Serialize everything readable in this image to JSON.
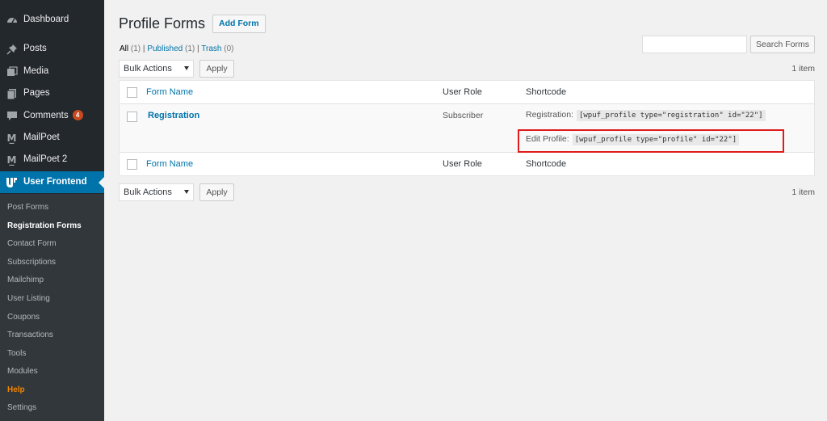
{
  "sidebar": {
    "menu": [
      {
        "label": "Dashboard",
        "icon": "dashboard-icon"
      },
      {
        "label": "Posts",
        "icon": "pin-icon"
      },
      {
        "label": "Media",
        "icon": "media-icon"
      },
      {
        "label": "Pages",
        "icon": "pages-icon"
      },
      {
        "label": "Comments",
        "icon": "comment-icon",
        "badge": "4"
      },
      {
        "label": "MailPoet",
        "icon": "mailpoet-icon"
      },
      {
        "label": "MailPoet 2",
        "icon": "mailpoet-icon"
      },
      {
        "label": "User Frontend",
        "icon": "wpuf-icon"
      }
    ],
    "submenu": [
      {
        "label": "Post Forms"
      },
      {
        "label": "Registration Forms"
      },
      {
        "label": "Contact Form"
      },
      {
        "label": "Subscriptions"
      },
      {
        "label": "Mailchimp"
      },
      {
        "label": "User Listing"
      },
      {
        "label": "Coupons"
      },
      {
        "label": "Transactions"
      },
      {
        "label": "Tools"
      },
      {
        "label": "Modules"
      },
      {
        "label": "Help"
      },
      {
        "label": "Settings"
      }
    ],
    "colors": {
      "bg": "#23282d",
      "active": "#0073aa",
      "submenu_bg": "#32373c",
      "help": "#f18500",
      "badge": "#ca4a1f"
    }
  },
  "main": {
    "title": "Profile Forms",
    "add_button": "Add Form",
    "filters": {
      "all": "All",
      "all_count": "(1)",
      "published": "Published",
      "published_count": "(1)",
      "trash": "Trash",
      "trash_count": "(0)",
      "sep": "|"
    },
    "search": {
      "placeholder": "",
      "button": "Search Forms"
    },
    "bulk_actions": "Bulk Actions",
    "apply": "Apply",
    "item_count": "1 item",
    "table": {
      "headers": {
        "name": "Form Name",
        "role": "User Role",
        "shortcode": "Shortcode"
      },
      "row": {
        "name": "Registration",
        "role": "Subscriber",
        "reg_label": "Registration:",
        "reg_code": "[wpuf_profile type=\"registration\" id=\"22\"]",
        "edit_label": "Edit Profile:",
        "edit_code": "[wpuf_profile type=\"profile\" id=\"22\"]"
      }
    },
    "colors": {
      "link": "#0073aa",
      "highlight": "#e01b1b"
    }
  }
}
